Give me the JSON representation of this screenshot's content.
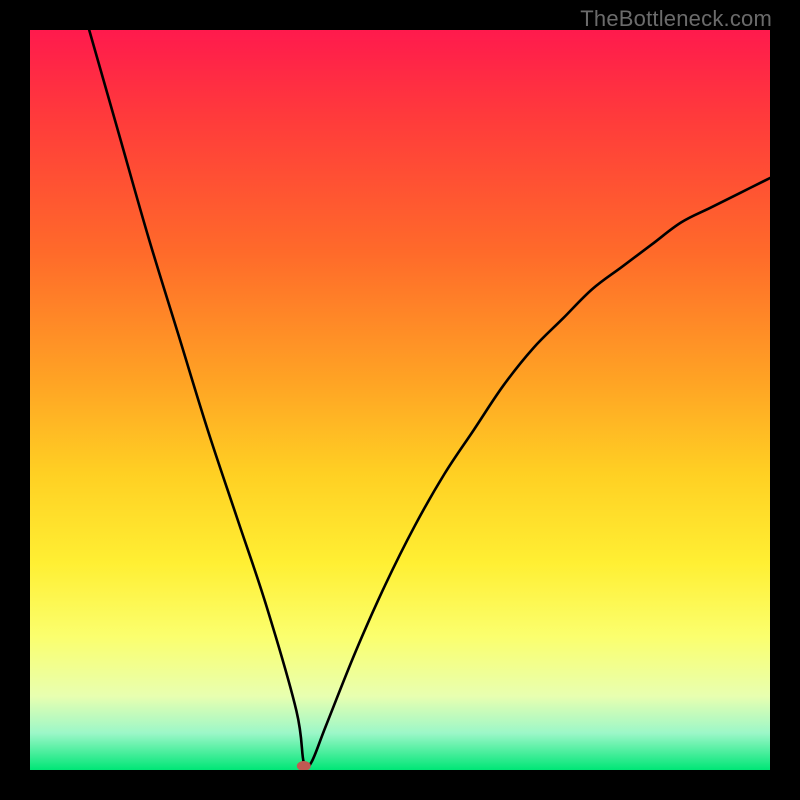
{
  "watermark": "TheBottleneck.com",
  "chart_data": {
    "type": "line",
    "title": "",
    "xlabel": "",
    "ylabel": "",
    "xlim": [
      0,
      100
    ],
    "ylim": [
      0,
      100
    ],
    "grid": false,
    "legend": false,
    "series": [
      {
        "name": "bottleneck-curve",
        "x": [
          8,
          12,
          16,
          20,
          24,
          28,
          32,
          36,
          37,
          38,
          40,
          44,
          48,
          52,
          56,
          60,
          64,
          68,
          72,
          76,
          80,
          84,
          88,
          92,
          96,
          100
        ],
        "y": [
          100,
          86,
          72,
          59,
          46,
          34,
          22,
          8,
          1,
          1,
          6,
          16,
          25,
          33,
          40,
          46,
          52,
          57,
          61,
          65,
          68,
          71,
          74,
          76,
          78,
          80
        ]
      }
    ],
    "marker": {
      "name": "optimal-point",
      "x": 37,
      "y": 0,
      "color": "#c05a52"
    },
    "background": {
      "type": "vertical-gradient",
      "stops": [
        {
          "pos": 0,
          "color": "#ff1a4d"
        },
        {
          "pos": 12,
          "color": "#ff3b3b"
        },
        {
          "pos": 30,
          "color": "#ff6a2a"
        },
        {
          "pos": 48,
          "color": "#ffa524"
        },
        {
          "pos": 60,
          "color": "#ffd023"
        },
        {
          "pos": 72,
          "color": "#ffef33"
        },
        {
          "pos": 82,
          "color": "#fbff6e"
        },
        {
          "pos": 90,
          "color": "#e8ffb0"
        },
        {
          "pos": 95,
          "color": "#9cf7c8"
        },
        {
          "pos": 100,
          "color": "#00e676"
        }
      ]
    }
  }
}
